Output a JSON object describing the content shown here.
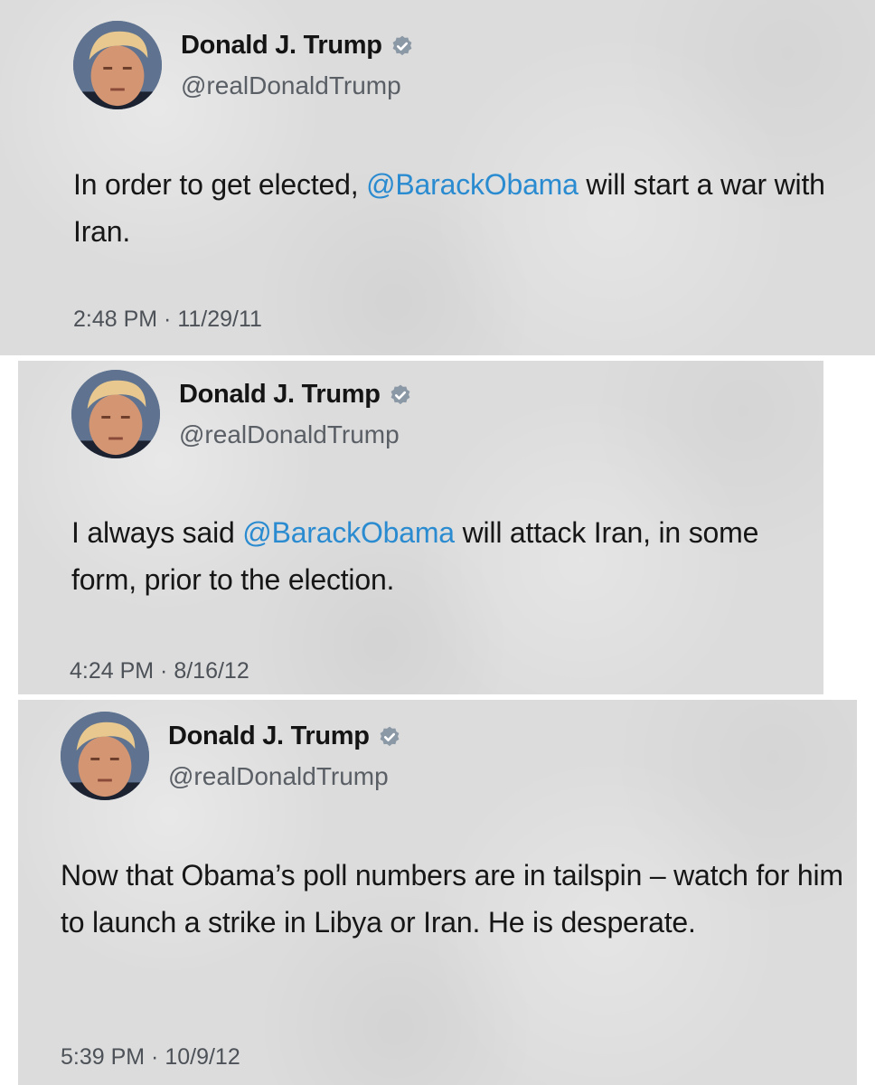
{
  "tweets": [
    {
      "author": {
        "display_name": "Donald J. Trump",
        "handle": "@realDonaldTrump",
        "verified_icon": "verified-badge-icon"
      },
      "text": {
        "before": "In order to get elected, ",
        "mention": "@BarackObama",
        "after": " will start a war with Iran."
      },
      "timestamp": "2:48 PM · 11/29/11"
    },
    {
      "author": {
        "display_name": "Donald J. Trump",
        "handle": "@realDonaldTrump",
        "verified_icon": "verified-badge-icon"
      },
      "text": {
        "before": "I always said ",
        "mention": "@BarackObama",
        "after": " will attack Iran, in some form, prior to the election."
      },
      "timestamp": "4:24 PM · 8/16/12"
    },
    {
      "author": {
        "display_name": "Donald J. Trump",
        "handle": "@realDonaldTrump",
        "verified_icon": "verified-badge-icon"
      },
      "text": {
        "before": "Now that Obama’s poll numbers are in tailspin – watch for him to launch a strike in Libya or Iran.  He is desperate.",
        "mention": "",
        "after": ""
      },
      "timestamp": "5:39 PM · 10/9/12"
    }
  ],
  "colors": {
    "card_background": "#dcdcdc",
    "mention": "#2a8bd0",
    "verified_badge": "#8b98a5",
    "text": "#161616",
    "secondary_text": "#5a5f66"
  }
}
